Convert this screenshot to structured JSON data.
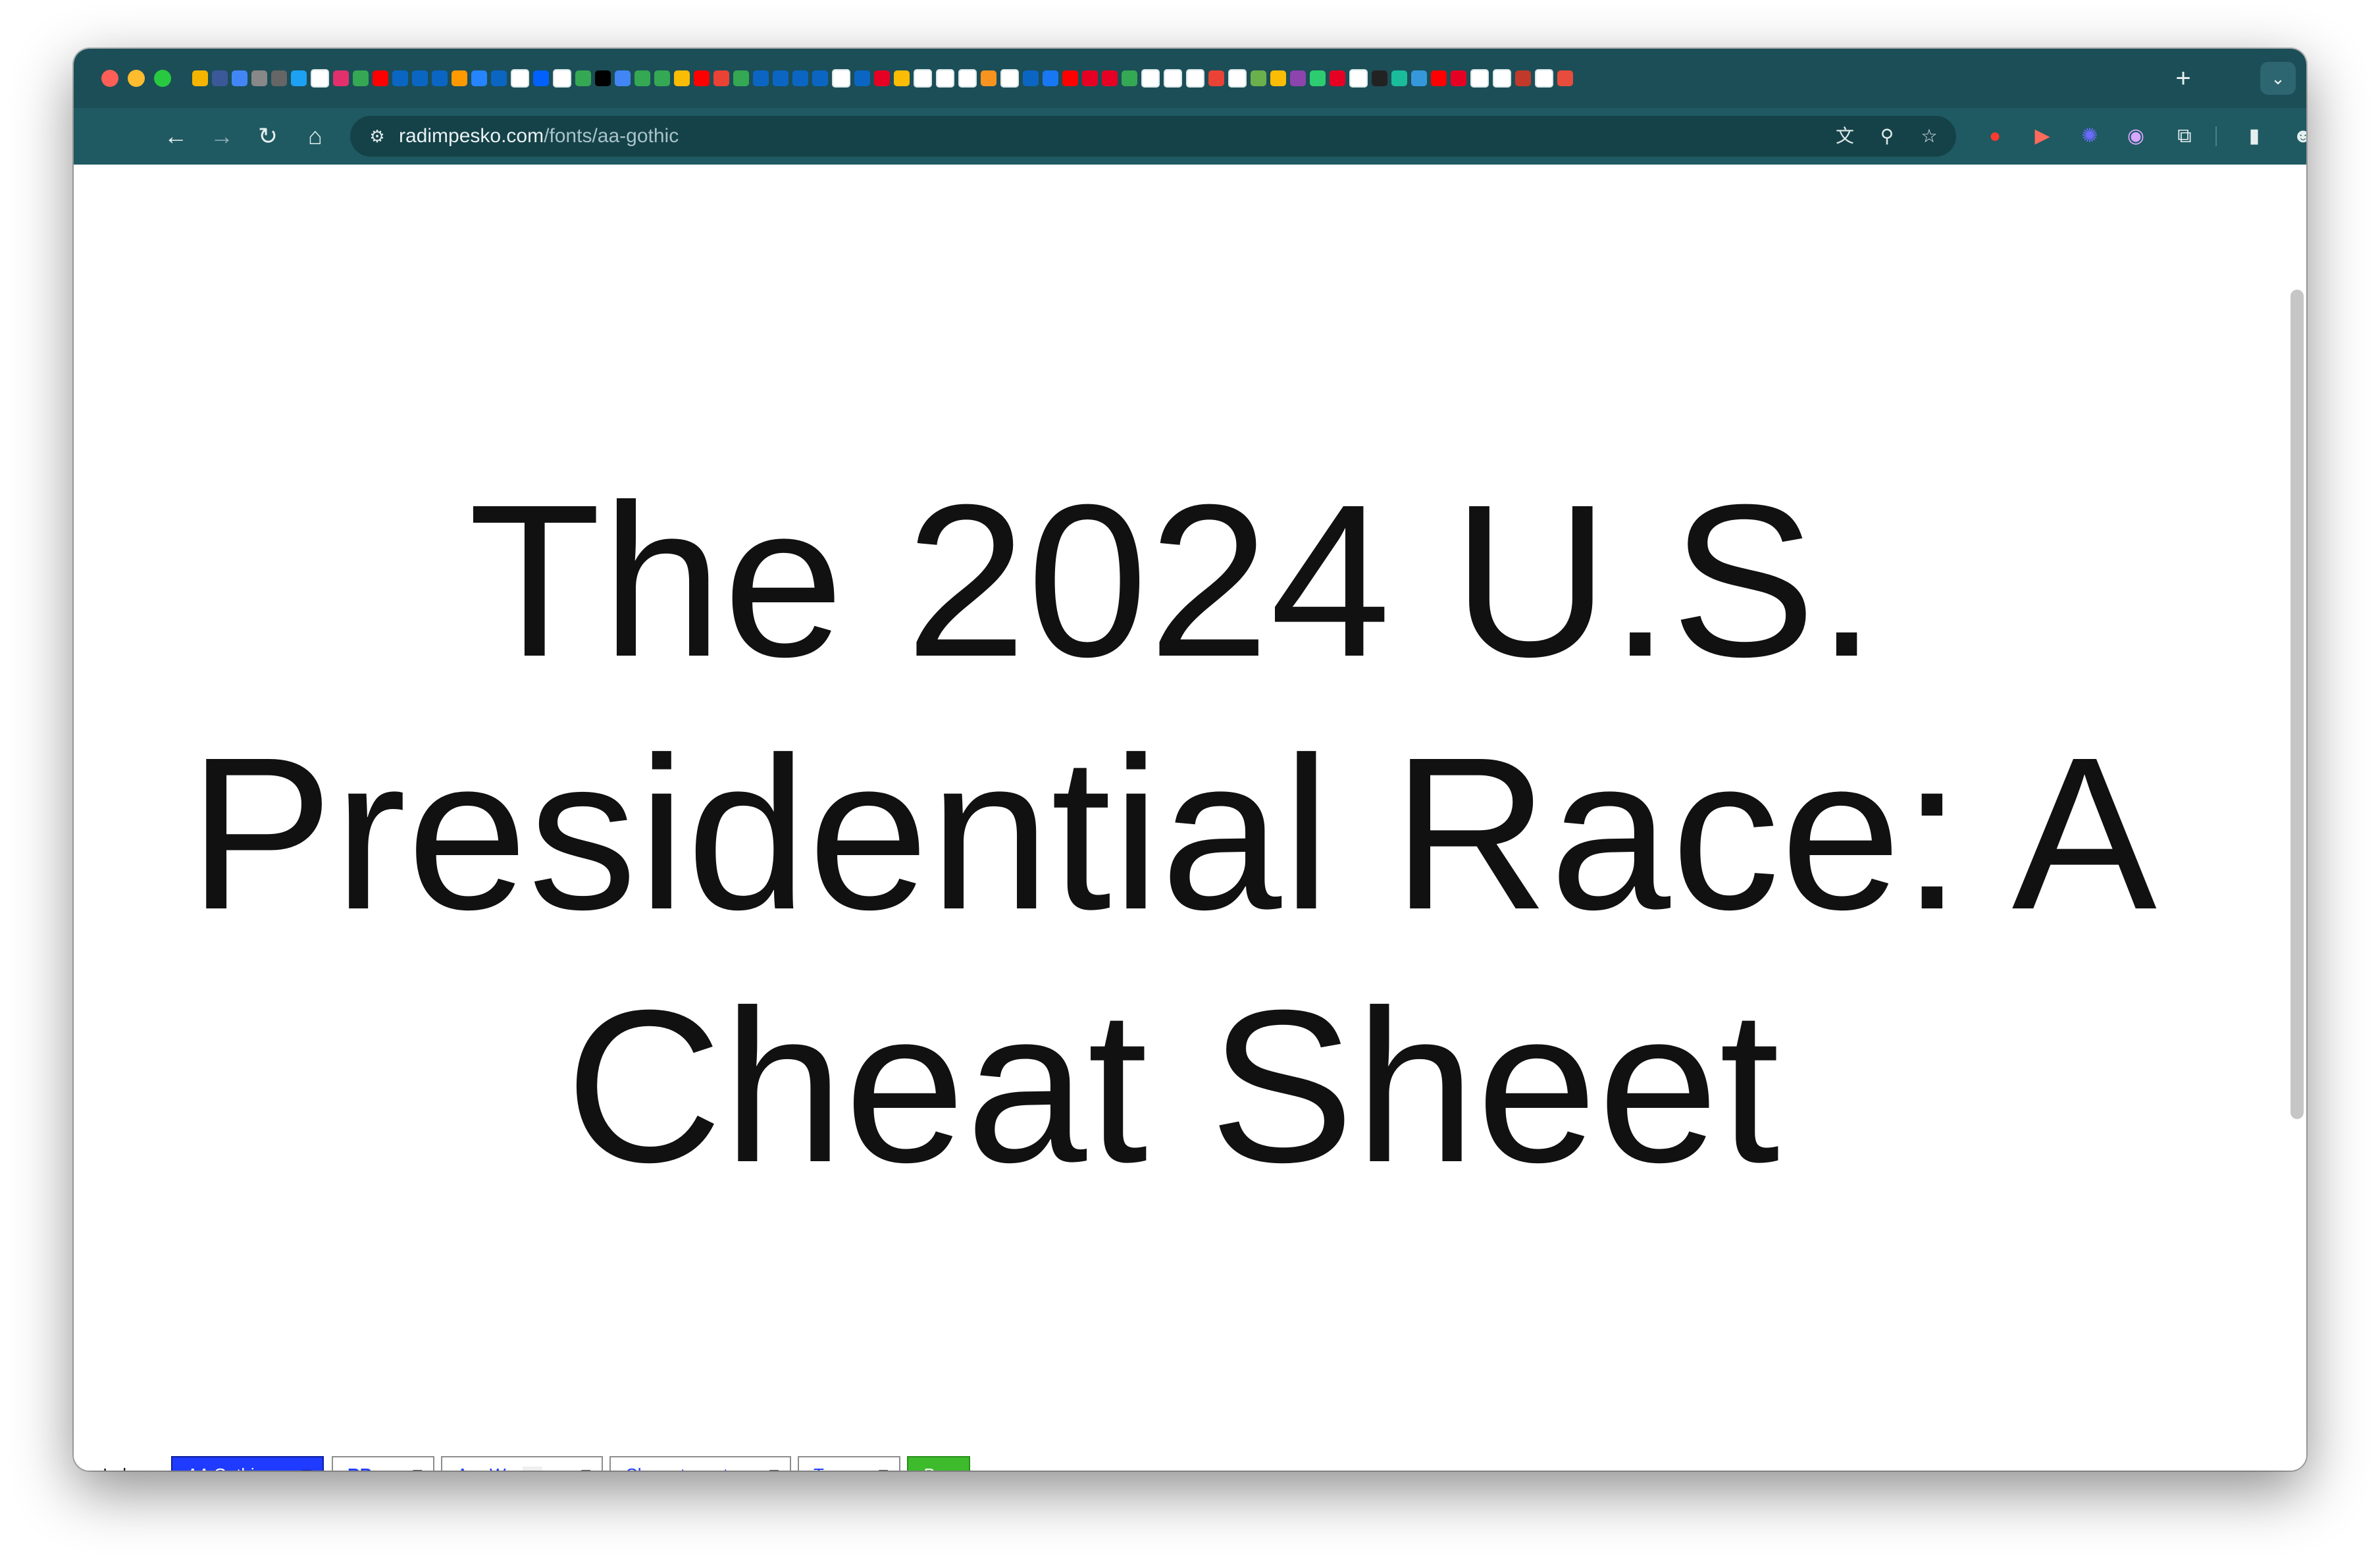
{
  "browser": {
    "favicon_colors": [
      "#f4b400",
      "#3b5998",
      "#4285f4",
      "#888888",
      "#666666",
      "#1da1f2",
      "#ffffff",
      "#e1306c",
      "#34a853",
      "#ff0000",
      "#0a66c2",
      "#0a66c2",
      "#0a66c2",
      "#ff9900",
      "#2684ff",
      "#0a66c2",
      "#ffffff",
      "#0061ff",
      "#ffffff",
      "#34a853",
      "#000000",
      "#4285f4",
      "#34a853",
      "#34a853",
      "#fbbc05",
      "#ff0000",
      "#ea4335",
      "#34a853",
      "#0a66c2",
      "#0a66c2",
      "#0a66c2",
      "#0a66c2",
      "#ffffff",
      "#0a66c2",
      "#e60023",
      "#fbbc05",
      "#ffffff",
      "#ffffff",
      "#ffffff",
      "#f7931e",
      "#ffffff",
      "#0a66c2",
      "#1877f2",
      "#ff0000",
      "#e60023",
      "#e60023",
      "#34a853",
      "#ffffff",
      "#ffffff",
      "#ffffff",
      "#ea4335",
      "#ffffff",
      "#6ab04c",
      "#fbbc05",
      "#8e44ad",
      "#2ecc71",
      "#e60023",
      "#ffffff",
      "#222222",
      "#1abc9c",
      "#3498db",
      "#ff0000",
      "#e60023",
      "#ffffff",
      "#ffffff",
      "#c0392b",
      "#ffffff",
      "#e74c3c"
    ],
    "new_tab_label": "+",
    "tab_search_label": "⌄"
  },
  "toolbar": {
    "back_icon": "←",
    "forward_icon": "→",
    "reload_icon": "↻",
    "home_icon": "⌂",
    "site_info_icon": "⚙",
    "url_host": "radimpesko.com",
    "url_path": "/fonts/aa-gothic",
    "translate_icon": "文",
    "zoom_icon": "⚲",
    "bookmark_icon": "☆",
    "ext1_icon": "●",
    "ext2_icon": "▶",
    "ext3_icon": "✺",
    "ext4_icon": "◉",
    "extensions_icon": "⧉",
    "sidepanel_icon": "▮",
    "profile_icon": "☻",
    "menu_icon": "⋮"
  },
  "page": {
    "headline_line1": "The 2024 U.S.",
    "headline_line2": "Presidential Race: A",
    "headline_line3": "Cheat Sheet"
  },
  "footer": {
    "index_label": "Index",
    "font_select": "AA Gothic",
    "style_select": "RB",
    "text_select_aa": "Aa",
    "text_select_w": "W",
    "charset_select": "Character set",
    "try_select": "Try",
    "buy_label": "Buy",
    "more_label": "...",
    "arrow": "▼"
  }
}
